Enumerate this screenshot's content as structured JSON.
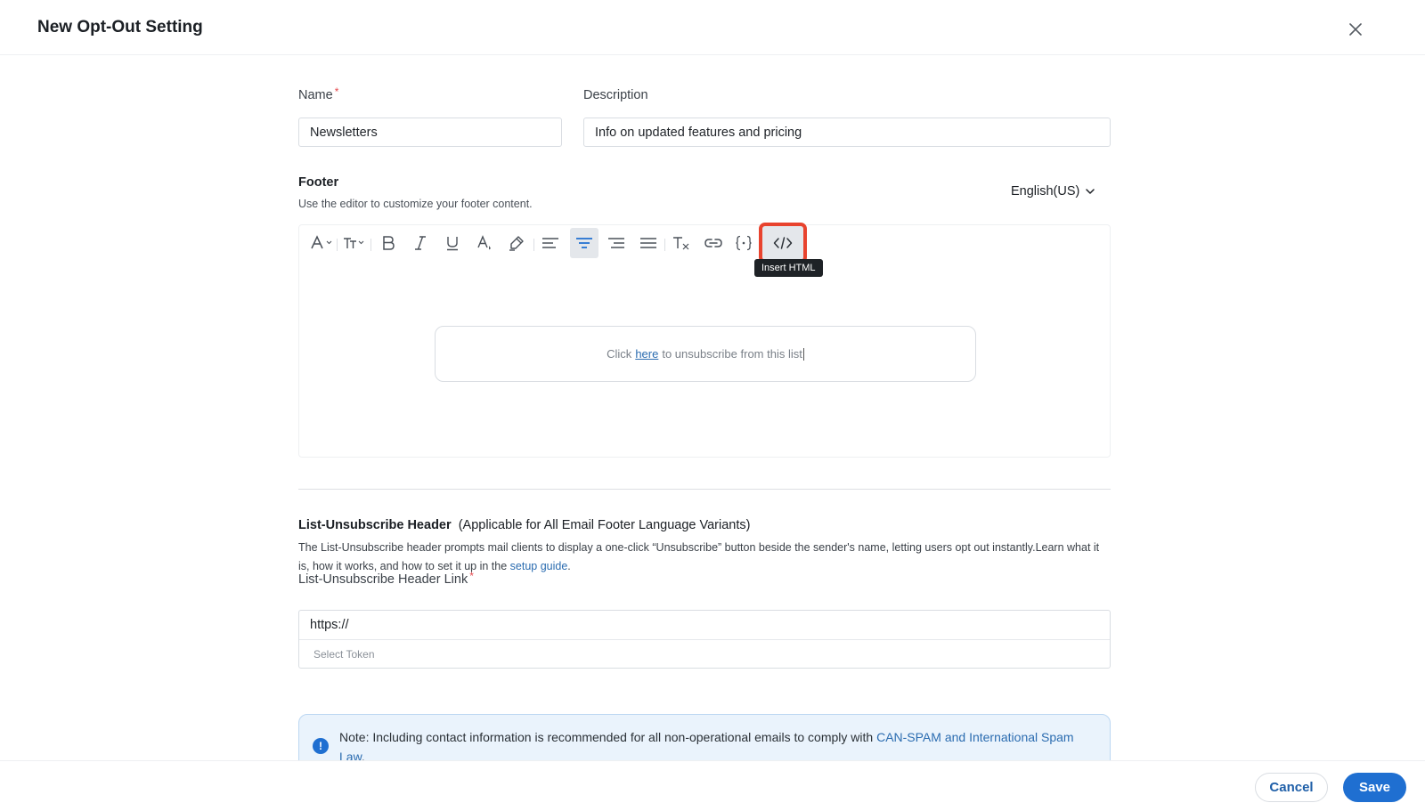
{
  "dialog": {
    "title": "New Opt-Out Setting"
  },
  "form": {
    "name_label": "Name",
    "required_mark": "*",
    "name_value": "Newsletters",
    "description_label": "Description",
    "description_value": "Info on updated features and pricing"
  },
  "footer": {
    "title": "Footer",
    "hint": "Use the editor to customize your footer content.",
    "language": "English(US)",
    "toolbar": {
      "tooltip": "Insert HTML",
      "tools": [
        "font-family-icon",
        "font-size-icon",
        "bold-icon",
        "italic-icon",
        "underline-icon",
        "text-color-icon",
        "highlight-icon",
        "align-left-icon",
        "align-center-icon",
        "align-right-icon",
        "justify-icon",
        "clear-format-icon",
        "link-icon",
        "insert-token-icon",
        "insert-html-icon"
      ],
      "active_tool": "align-center-icon"
    },
    "preview": {
      "before": "Click",
      "link": "here",
      "after": "to unsubscribe from this list"
    }
  },
  "list_unsubscribe": {
    "title": "List-Unsubscribe Header",
    "subtitle": "(Applicable for All Email Footer Language Variants)",
    "description": "The List-Unsubscribe header prompts mail clients to display a one-click “Unsubscribe” button beside the sender's name, letting users opt out instantly.Learn what it is, how it works, and how to set it up in the",
    "guide_link": "setup guide",
    "guide_end": ".",
    "link_label": "List-Unsubscribe Header Link",
    "link_value": "https://",
    "token_placeholder": "Select Token"
  },
  "note": {
    "text": "Note: Including contact information is recommended for all non-operational emails to comply with",
    "link": "CAN-SPAM and International Spam Law",
    "end": "."
  },
  "actions": {
    "cancel": "Cancel",
    "save": "Save"
  },
  "colors": {
    "accent": "#1f6fd1",
    "highlight_box": "#e8432e",
    "note_background": "#eaf3fc"
  }
}
